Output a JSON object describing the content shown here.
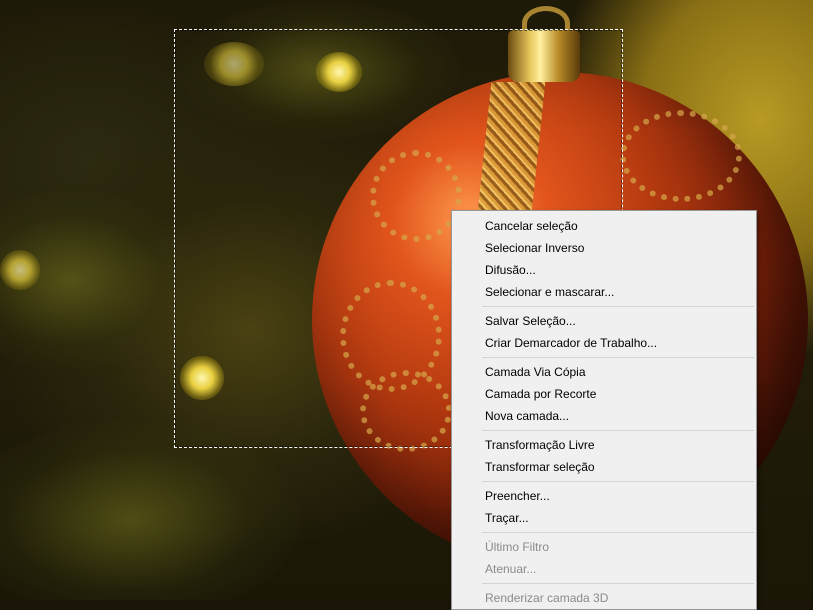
{
  "canvas": {
    "description_icon": "photo-canvas"
  },
  "context_menu": {
    "groups": [
      {
        "items": [
          {
            "label": "Cancelar seleção",
            "enabled": true
          },
          {
            "label": "Selecionar Inverso",
            "enabled": true
          },
          {
            "label": "Difusão...",
            "enabled": true
          },
          {
            "label": "Selecionar e mascarar...",
            "enabled": true
          }
        ]
      },
      {
        "items": [
          {
            "label": "Salvar Seleção...",
            "enabled": true
          },
          {
            "label": "Criar Demarcador de Trabalho...",
            "enabled": true
          }
        ]
      },
      {
        "items": [
          {
            "label": "Camada Via Cópia",
            "enabled": true
          },
          {
            "label": "Camada por Recorte",
            "enabled": true
          },
          {
            "label": "Nova camada...",
            "enabled": true
          }
        ]
      },
      {
        "items": [
          {
            "label": "Transformação Livre",
            "enabled": true
          },
          {
            "label": "Transformar seleção",
            "enabled": true
          }
        ]
      },
      {
        "items": [
          {
            "label": "Preencher...",
            "enabled": true
          },
          {
            "label": "Traçar...",
            "enabled": true
          }
        ]
      },
      {
        "items": [
          {
            "label": "Último Filtro",
            "enabled": false
          },
          {
            "label": "Atenuar...",
            "enabled": false
          }
        ]
      },
      {
        "items": [
          {
            "label": "Renderizar camada 3D",
            "enabled": false
          }
        ]
      }
    ]
  }
}
